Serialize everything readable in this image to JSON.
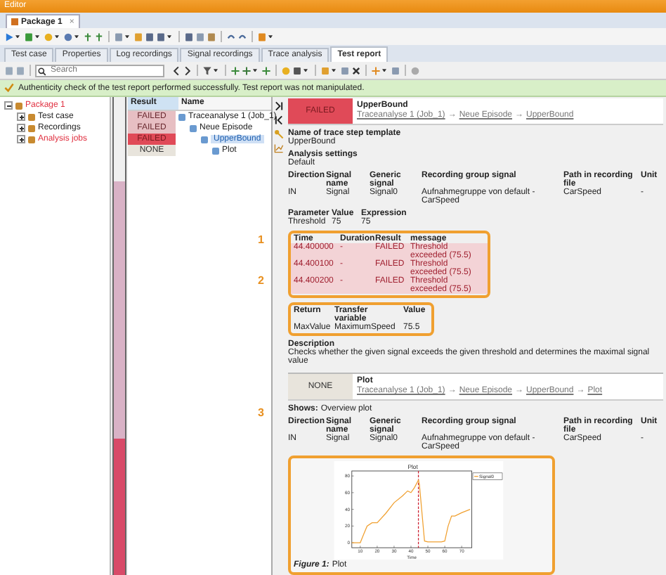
{
  "window": {
    "title": "Editor"
  },
  "document_tab": {
    "label": "Package 1",
    "close": "×"
  },
  "tabs": [
    {
      "label": "Test case",
      "selected": false
    },
    {
      "label": "Properties",
      "selected": false
    },
    {
      "label": "Log recordings",
      "selected": false
    },
    {
      "label": "Signal recordings",
      "selected": false
    },
    {
      "label": "Trace analysis",
      "selected": false
    },
    {
      "label": "Test report",
      "selected": true
    }
  ],
  "search": {
    "placeholder": "Search"
  },
  "notification": "Authenticity check of the test report performed successfully. Test report was not manipulated.",
  "project_tree": [
    {
      "label": "Package 1",
      "failed": true,
      "expanded": true,
      "children": [
        {
          "label": "Test case",
          "failed": false,
          "expanded": false
        },
        {
          "label": "Recordings",
          "failed": false,
          "expanded": false
        },
        {
          "label": "Analysis jobs",
          "failed": true,
          "expanded": false
        }
      ]
    }
  ],
  "results": {
    "columns": [
      "Result",
      "Name"
    ],
    "rows": [
      {
        "result": "FAILED",
        "name": "Traceanalyse 1 (Job_1)",
        "selected": false,
        "children": [
          {
            "result": "FAILED",
            "name": "Neue Episode",
            "selected": false,
            "children": [
              {
                "result": "FAILED",
                "name": "UpperBound",
                "selected": true,
                "children": [
                  {
                    "result": "NONE",
                    "name": "Plot",
                    "selected": false
                  }
                ]
              }
            ]
          }
        ]
      }
    ]
  },
  "report": {
    "step": {
      "result": "FAILED",
      "title": "UpperBound",
      "breadcrumb": [
        "Traceanalyse 1 (Job_1)",
        "Neue Episode",
        "UpperBound"
      ],
      "separator": "→"
    },
    "template": {
      "label": "Name of trace step template",
      "value": "UpperBound"
    },
    "settings": {
      "label": "Analysis settings",
      "value": "Default"
    },
    "signal_table": {
      "columns": [
        "Direction",
        "Signal name",
        "Generic signal",
        "Recording group signal",
        "Path in recording file",
        "Unit"
      ],
      "rows": [
        [
          "IN",
          "Signal",
          "Signal0",
          "Aufnahmegruppe von default - CarSpeed",
          "CarSpeed",
          "-"
        ]
      ]
    },
    "parameter_table": {
      "columns": [
        "Parameter",
        "Value",
        "Expression"
      ],
      "rows": [
        [
          "Threshold",
          "75",
          "75"
        ]
      ]
    },
    "events_table": {
      "annotation": "1",
      "columns": [
        "Time",
        "Duration",
        "Result",
        "message"
      ],
      "rows": [
        {
          "failed": true,
          "cells": [
            "44.400000",
            "-",
            "FAILED",
            "Threshold exceeded (75.5)"
          ]
        },
        {
          "failed": true,
          "cells": [
            "44.400100",
            "-",
            "FAILED",
            "Threshold exceeded (75.5)"
          ]
        },
        {
          "failed": true,
          "cells": [
            "44.400200",
            "-",
            "FAILED",
            "Threshold exceeded (75.5)"
          ]
        }
      ]
    },
    "return_table": {
      "annotation": "2",
      "columns": [
        "Return",
        "Transfer variable",
        "Value"
      ],
      "rows": [
        [
          "MaxValue",
          "MaximumSpeed",
          "75.5"
        ]
      ]
    },
    "description": {
      "label": "Description",
      "value": "Checks whether the given signal exceeds the given threshold and determines the maximal signal value"
    },
    "plot_step": {
      "result": "NONE",
      "title": "Plot",
      "breadcrumb": [
        "Traceanalyse 1 (Job_1)",
        "Neue Episode",
        "UpperBound",
        "Plot"
      ],
      "separator": "→",
      "shows_label": "Shows:",
      "shows_value": "Overview plot"
    },
    "plot_signal_table": {
      "columns": [
        "Direction",
        "Signal name",
        "Generic signal",
        "Recording group signal",
        "Path in recording file",
        "Unit"
      ],
      "rows": [
        [
          "IN",
          "Signal",
          "Signal0",
          "Aufnahmegruppe von default - CarSpeed",
          "CarSpeed",
          "-"
        ]
      ]
    },
    "figure": {
      "annotation": "3",
      "caption_label": "Figure 1:",
      "caption": "Plot",
      "chart_data": {
        "type": "line",
        "title": "Plot",
        "xlabel": "Time",
        "x": [
          5,
          10,
          12,
          14,
          17,
          20,
          25,
          30,
          35,
          38,
          40,
          42,
          44.4,
          45,
          48,
          50,
          55,
          58,
          60,
          62,
          64,
          66,
          70,
          75
        ],
        "series": [
          {
            "name": "Signal0",
            "color": "#f0a030",
            "values": [
              0,
              0,
              10,
              20,
              24,
              24,
              35,
              48,
              56,
              62,
              60,
              66,
              75,
              70,
              2,
              1,
              1,
              1,
              2,
              20,
              32,
              32,
              36,
              40
            ]
          }
        ],
        "xlim": [
          5,
          76
        ],
        "ylim": [
          -6,
          86
        ],
        "xticks": [
          10,
          20,
          30,
          40,
          50,
          60,
          70
        ],
        "yticks": [
          0,
          20,
          40,
          60,
          80
        ],
        "ref_lines": [
          {
            "axis": "x",
            "value": 44.4,
            "color": "#cc2030"
          }
        ]
      }
    }
  }
}
